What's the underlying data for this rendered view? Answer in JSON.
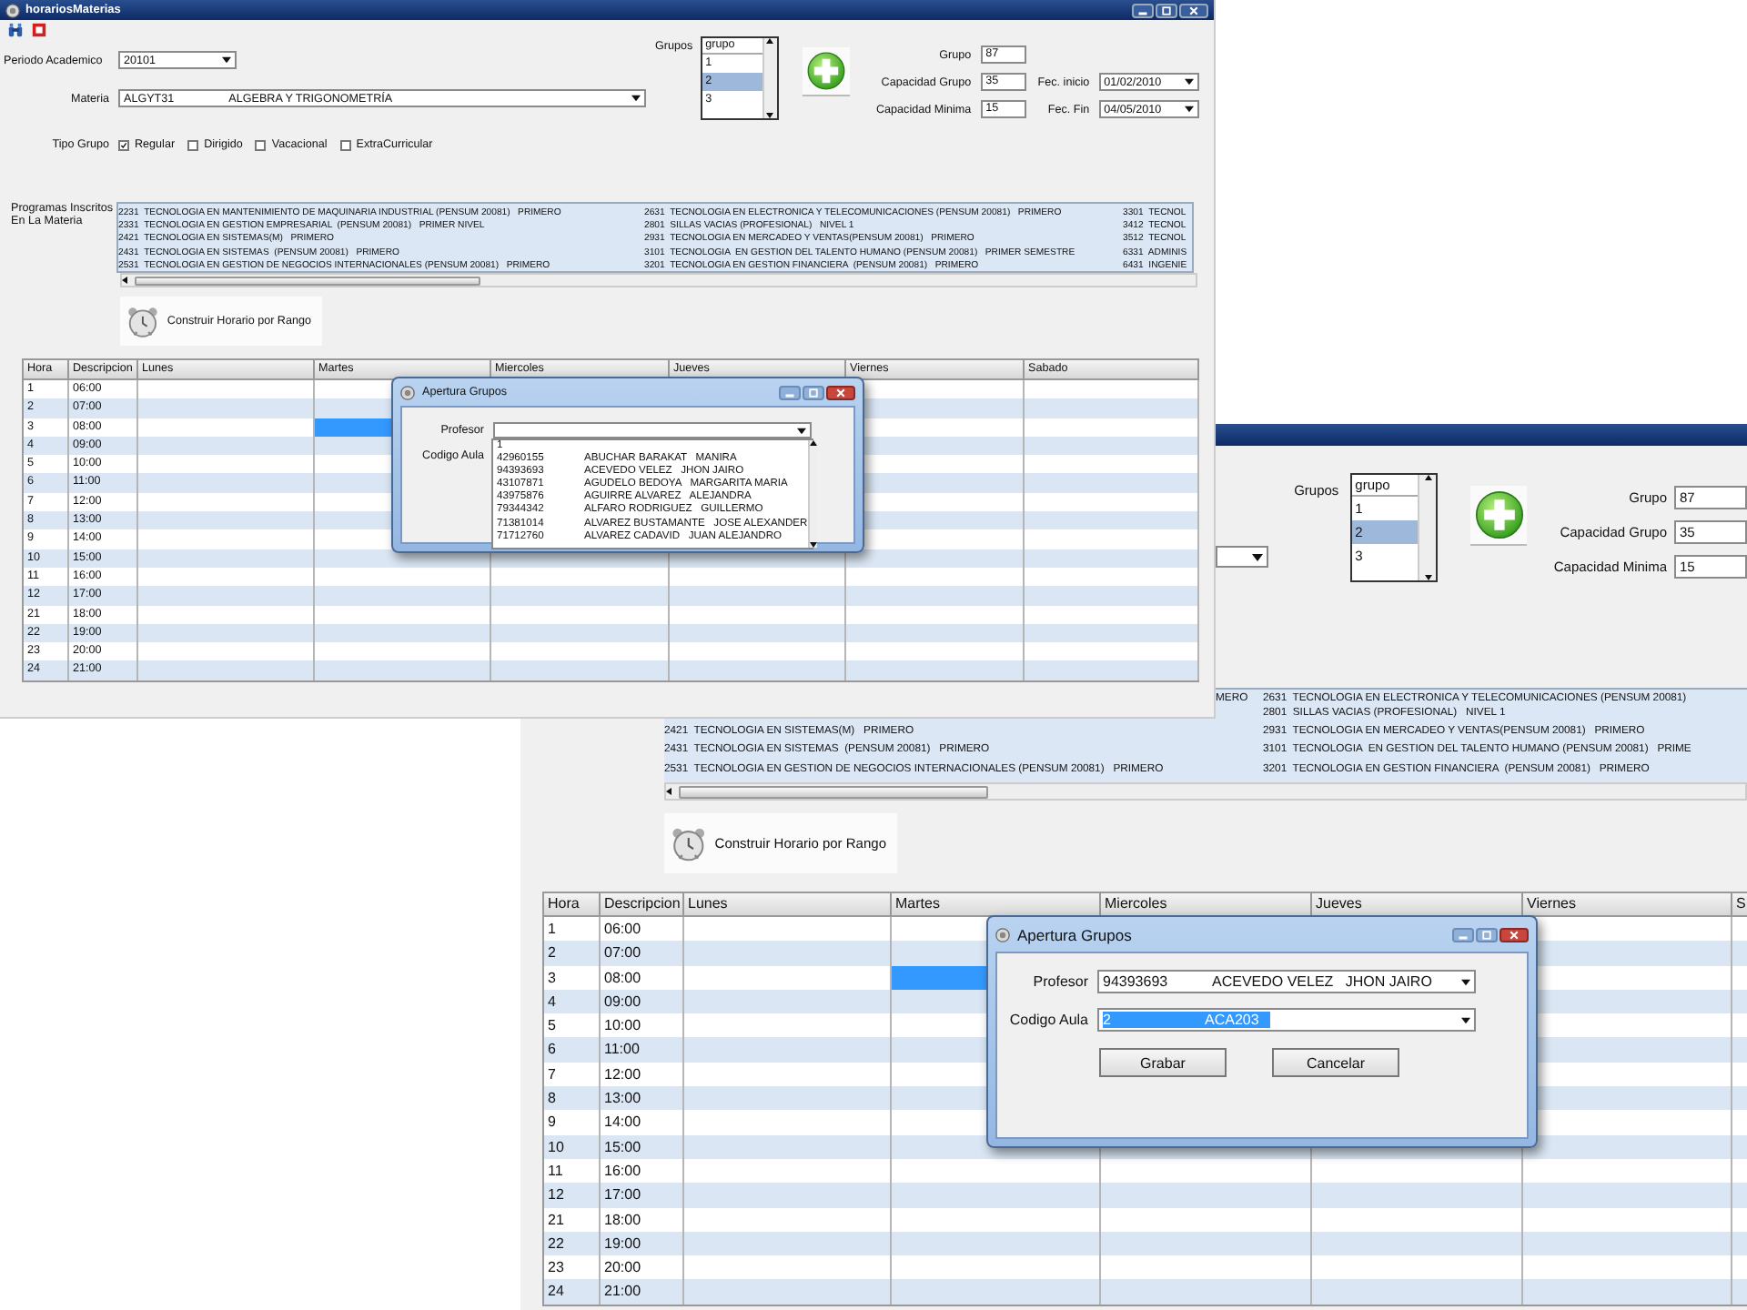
{
  "screenshot_1": {
    "window": {
      "title": "horariosMaterias"
    },
    "form": {
      "periodo": {
        "label": "Periodo Academico",
        "value": "20101"
      },
      "materia": {
        "label": "Materia",
        "code": "ALGYT31",
        "name": "ALGEBRA Y TRIGONOMETRÍA"
      },
      "tipo_grupo": {
        "label": "Tipo Grupo",
        "options": [
          {
            "label": "Regular",
            "checked": true
          },
          {
            "label": "Dirigido",
            "checked": false
          },
          {
            "label": "Vacacional",
            "checked": false
          },
          {
            "label": "ExtraCurricular",
            "checked": false
          }
        ]
      },
      "grupos": {
        "label": "Grupos",
        "header": "grupo",
        "items": [
          {
            "label": "1",
            "selected": false
          },
          {
            "label": "2",
            "selected": true
          },
          {
            "label": "3",
            "selected": false
          }
        ]
      },
      "fields": [
        {
          "label": "Grupo",
          "value": "87"
        },
        {
          "label": "Capacidad Grupo",
          "value": "35"
        },
        {
          "label": "Capacidad Minima",
          "value": "15"
        }
      ],
      "dates": [
        {
          "label": "Fec. inicio",
          "value": "01/02/2010"
        },
        {
          "label": "Fec. Fin",
          "value": "04/05/2010"
        }
      ]
    },
    "programs": {
      "label": "Programas Inscritos En La Materia",
      "rows": [
        {
          "col_1": "2231  TECNOLOGIA EN MANTENIMIENTO DE MAQUINARIA INDUSTRIAL (PENSUM 20081)   PRIMERO",
          "col_2": "2631  TECNOLOGIA EN ELECTRONICA Y TELECOMUNICACIONES (PENSUM 20081)   PRIMERO",
          "col_3": "3301  TECNOL"
        },
        {
          "col_1": "2331  TECNOLOGIA EN GESTION EMPRESARIAL  (PENSUM 20081)   PRIMER NIVEL",
          "col_2": "2801  SILLAS VACIAS (PROFESIONAL)   NIVEL 1",
          "col_3": "3412  TECNOL"
        },
        {
          "col_1": "2421  TECNOLOGIA EN SISTEMAS(M)   PRIMERO",
          "col_2": "2931  TECNOLOGIA EN MERCADEO Y VENTAS(PENSUM 20081)   PRIMERO",
          "col_3": "3512  TECNOL"
        },
        {
          "col_1": "2431  TECNOLOGIA EN SISTEMAS  (PENSUM 20081)   PRIMERO",
          "col_2": "3101  TECNOLOGIA  EN GESTION DEL TALENTO HUMANO (PENSUM 20081)   PRIMER SEMESTRE",
          "col_3": "6331  ADMINIS"
        },
        {
          "col_1": "2531  TECNOLOGIA EN GESTION DE NEGOCIOS INTERNACIONALES (PENSUM 20081)   PRIMERO",
          "col_2": "3201  TECNOLOGIA EN GESTION FINANCIERA  (PENSUM 20081)   PRIMERO",
          "col_3": "6431  INGENIE"
        }
      ]
    },
    "build_button": "Construir Horario por Rango",
    "schedule": {
      "columns": [
        "Hora",
        "Descripcion",
        "Lunes",
        "Martes",
        "Miercoles",
        "Jueves",
        "Viernes",
        "Sabado"
      ],
      "rows": [
        {
          "hora": "1",
          "descripcion": "06:00",
          "cells": {
            "lunes": {
              "selected": false
            },
            "martes": {
              "selected": false
            },
            "viernes": {
              "selected": false
            },
            "sabado": {
              "selected": false
            }
          }
        },
        {
          "hora": "2",
          "descripcion": "07:00",
          "cells": {
            "lunes": {
              "selected": false
            },
            "martes": {
              "selected": false
            },
            "viernes": {
              "selected": false
            },
            "sabado": {
              "selected": false
            }
          }
        },
        {
          "hora": "3",
          "descripcion": "08:00",
          "cells": {
            "lunes": {
              "selected": false
            },
            "martes": {
              "selected": true
            },
            "viernes": {
              "selected": false
            },
            "sabado": {
              "selected": false
            }
          }
        },
        {
          "hora": "4",
          "descripcion": "09:00",
          "cells": {
            "lunes": {
              "selected": false
            },
            "martes": {
              "selected": false
            },
            "viernes": {
              "selected": false
            },
            "sabado": {
              "selected": false
            }
          }
        },
        {
          "hora": "5",
          "descripcion": "10:00",
          "cells": {
            "lunes": {
              "selected": false
            },
            "martes": {
              "selected": false
            },
            "viernes": {
              "selected": false
            },
            "sabado": {
              "selected": false
            }
          }
        },
        {
          "hora": "6",
          "descripcion": "11:00",
          "cells": {
            "lunes": {
              "selected": false
            },
            "martes": {
              "selected": false
            },
            "viernes": {
              "selected": false
            },
            "sabado": {
              "selected": false
            }
          }
        },
        {
          "hora": "7",
          "descripcion": "12:00",
          "cells": {
            "lunes": {
              "selected": false
            },
            "martes": {
              "selected": false
            },
            "viernes": {
              "selected": false
            },
            "sabado": {
              "selected": false
            }
          }
        },
        {
          "hora": "8",
          "descripcion": "13:00",
          "cells": {
            "lunes": {
              "selected": false
            },
            "martes": {
              "selected": false
            },
            "viernes": {
              "selected": false
            },
            "sabado": {
              "selected": false
            }
          }
        },
        {
          "hora": "9",
          "descripcion": "14:00",
          "cells": {
            "lunes": {
              "selected": false
            },
            "martes": {
              "selected": false
            },
            "viernes": {
              "selected": false
            },
            "sabado": {
              "selected": false
            }
          }
        },
        {
          "hora": "10",
          "descripcion": "15:00",
          "cells": {
            "lunes": {
              "selected": false
            },
            "martes": {
              "selected": false
            },
            "miercoles": {
              "selected": false
            },
            "jueves": {
              "selected": false
            },
            "viernes": {
              "selected": false
            },
            "sabado": {
              "selected": false
            }
          }
        },
        {
          "hora": "11",
          "descripcion": "16:00",
          "cells": {
            "lunes": {
              "selected": false
            },
            "martes": {
              "selected": false
            },
            "miercoles": {
              "selected": false
            },
            "jueves": {
              "selected": false
            },
            "viernes": {
              "selected": false
            },
            "sabado": {
              "selected": false
            }
          }
        },
        {
          "hora": "12",
          "descripcion": "17:00",
          "cells": {
            "lunes": {
              "selected": false
            },
            "martes": {
              "selected": false
            },
            "miercoles": {
              "selected": false
            },
            "jueves": {
              "selected": false
            },
            "viernes": {
              "selected": false
            },
            "sabado": {
              "selected": false
            }
          }
        },
        {
          "hora": "21",
          "descripcion": "18:00",
          "cells": {
            "lunes": {
              "selected": false
            },
            "martes": {
              "selected": false
            },
            "miercoles": {
              "selected": false
            },
            "jueves": {
              "selected": false
            },
            "viernes": {
              "selected": false
            },
            "sabado": {
              "selected": false
            }
          }
        },
        {
          "hora": "22",
          "descripcion": "19:00",
          "cells": {
            "lunes": {
              "selected": false
            },
            "martes": {
              "selected": false
            },
            "miercoles": {
              "selected": false
            },
            "jueves": {
              "selected": false
            },
            "viernes": {
              "selected": false
            },
            "sabado": {
              "selected": false
            }
          }
        },
        {
          "hora": "23",
          "descripcion": "20:00",
          "cells": {
            "lunes": {
              "selected": false
            },
            "martes": {
              "selected": false
            },
            "miercoles": {
              "selected": false
            },
            "jueves": {
              "selected": false
            },
            "viernes": {
              "selected": false
            },
            "sabado": {
              "selected": false
            }
          }
        },
        {
          "hora": "24",
          "descripcion": "21:00",
          "cells": {
            "lunes": {
              "selected": false
            },
            "martes": {
              "selected": false
            },
            "miercoles": {
              "selected": false
            },
            "jueves": {
              "selected": false
            },
            "viernes": {
              "selected": false
            },
            "sabado": {
              "selected": false
            }
          }
        }
      ]
    },
    "dialog": {
      "title": "Apertura Grupos",
      "profesor_label": "Profesor",
      "codigo_aula_label": "Codigo Aula",
      "dropdown_items": [
        {
          "code": "1"
        },
        {
          "code": "42960155",
          "name": "ABUCHAR BARAKAT   MANIRA"
        },
        {
          "code": "94393693",
          "name": "ACEVEDO VELEZ   JHON JAIRO"
        },
        {
          "code": "43107871",
          "name": "AGUDELO BEDOYA   MARGARITA MARIA"
        },
        {
          "code": "43975876",
          "name": "AGUIRRE ALVAREZ   ALEJANDRA"
        },
        {
          "code": "79344342",
          "name": "ALFARO RODRIGUEZ   GUILLERMO"
        },
        {
          "code": "71381014",
          "name": "ALVAREZ BUSTAMANTE   JOSE ALEXANDER"
        },
        {
          "code": "71712760",
          "name": "ALVAREZ CADAVID   JUAN ALEJANDRO"
        }
      ]
    }
  },
  "screenshot_2": {
    "form": {
      "grupos": {
        "label": "Grupos",
        "header": "grupo",
        "items": [
          {
            "label": "1",
            "selected": false
          },
          {
            "label": "2",
            "selected": true
          },
          {
            "label": "3",
            "selected": false
          }
        ]
      },
      "fields": [
        {
          "label": "Grupo",
          "value": "87"
        },
        {
          "label": "Capacidad Grupo",
          "value": "35"
        },
        {
          "label": "Capacidad Minima",
          "value": "15"
        }
      ]
    },
    "programs": {
      "upper_rows": [
        {
          "col_1": "MERO",
          "col_2": "2631  TECNOLOGIA EN ELECTRONICA Y TELECOMUNICACIONES (PENSUM 20081)"
        },
        {
          "col_2": "2801  SILLAS VACIAS (PROFESIONAL)   NIVEL 1"
        }
      ],
      "rows": [
        {
          "col_1": "2421  TECNOLOGIA EN SISTEMAS(M)   PRIMERO",
          "col_2": "2931  TECNOLOGIA EN MERCADEO Y VENTAS(PENSUM 20081)   PRIMERO"
        },
        {
          "col_1": "2431  TECNOLOGIA EN SISTEMAS  (PENSUM 20081)   PRIMERO",
          "col_2": "3101  TECNOLOGIA  EN GESTION DEL TALENTO HUMANO (PENSUM 20081)   PRIME"
        },
        {
          "col_1": "2531  TECNOLOGIA EN GESTION DE NEGOCIOS INTERNACIONALES (PENSUM 20081)   PRIMERO",
          "col_2": "3201  TECNOLOGIA EN GESTION FINANCIERA  (PENSUM 20081)   PRIMERO"
        }
      ]
    },
    "build_button": "Construir Horario por Rango",
    "schedule": {
      "columns": [
        "Hora",
        "Descripcion",
        "Lunes",
        "Martes",
        "Miercoles",
        "Jueves",
        "Viernes",
        "S"
      ],
      "rows": [
        {
          "hora": "1",
          "descripcion": "06:00",
          "cells": {
            "lunes": {
              "selected": false
            },
            "martes": {
              "selected": false
            },
            "viernes": {
              "selected": false
            },
            "column_8": {
              "selected": false
            }
          }
        },
        {
          "hora": "2",
          "descripcion": "07:00",
          "cells": {
            "lunes": {
              "selected": false
            },
            "martes": {
              "selected": false
            },
            "viernes": {
              "selected": false
            },
            "column_8": {
              "selected": false
            }
          }
        },
        {
          "hora": "3",
          "descripcion": "08:00",
          "cells": {
            "lunes": {
              "selected": false
            },
            "martes": {
              "selected": true
            },
            "viernes": {
              "selected": false
            },
            "column_8": {
              "selected": false
            }
          }
        },
        {
          "hora": "4",
          "descripcion": "09:00",
          "cells": {
            "lunes": {
              "selected": false
            },
            "martes": {
              "selected": false
            },
            "viernes": {
              "selected": false
            },
            "column_8": {
              "selected": false
            }
          }
        },
        {
          "hora": "5",
          "descripcion": "10:00",
          "cells": {
            "lunes": {
              "selected": false
            },
            "martes": {
              "selected": false
            },
            "viernes": {
              "selected": false
            },
            "column_8": {
              "selected": false
            }
          }
        },
        {
          "hora": "6",
          "descripcion": "11:00",
          "cells": {
            "lunes": {
              "selected": false
            },
            "martes": {
              "selected": false
            },
            "viernes": {
              "selected": false
            },
            "column_8": {
              "selected": false
            }
          }
        },
        {
          "hora": "7",
          "descripcion": "12:00",
          "cells": {
            "lunes": {
              "selected": false
            },
            "martes": {
              "selected": false
            },
            "viernes": {
              "selected": false
            },
            "column_8": {
              "selected": false
            }
          }
        },
        {
          "hora": "8",
          "descripcion": "13:00",
          "cells": {
            "lunes": {
              "selected": false
            },
            "martes": {
              "selected": false
            },
            "viernes": {
              "selected": false
            },
            "column_8": {
              "selected": false
            }
          }
        },
        {
          "hora": "9",
          "descripcion": "14:00",
          "cells": {
            "lunes": {
              "selected": false
            },
            "martes": {
              "selected": false
            },
            "viernes": {
              "selected": false
            },
            "column_8": {
              "selected": false
            }
          }
        },
        {
          "hora": "10",
          "descripcion": "15:00",
          "cells": {
            "lunes": {
              "selected": false
            },
            "martes": {
              "selected": false
            },
            "miercoles": {
              "selected": false
            },
            "jueves": {
              "selected": false
            },
            "viernes": {
              "selected": false
            },
            "column_8": {
              "selected": false
            }
          }
        },
        {
          "hora": "11",
          "descripcion": "16:00",
          "cells": {
            "lunes": {
              "selected": false
            },
            "martes": {
              "selected": false
            },
            "miercoles": {
              "selected": false
            },
            "jueves": {
              "selected": false
            },
            "viernes": {
              "selected": false
            },
            "column_8": {
              "selected": false
            }
          }
        },
        {
          "hora": "12",
          "descripcion": "17:00",
          "cells": {
            "lunes": {
              "selected": false
            },
            "martes": {
              "selected": false
            },
            "miercoles": {
              "selected": false
            },
            "jueves": {
              "selected": false
            },
            "viernes": {
              "selected": false
            },
            "column_8": {
              "selected": false
            }
          }
        },
        {
          "hora": "21",
          "descripcion": "18:00",
          "cells": {
            "lunes": {
              "selected": false
            },
            "martes": {
              "selected": false
            },
            "miercoles": {
              "selected": false
            },
            "jueves": {
              "selected": false
            },
            "viernes": {
              "selected": false
            },
            "column_8": {
              "selected": false
            }
          }
        },
        {
          "hora": "22",
          "descripcion": "19:00",
          "cells": {
            "lunes": {
              "selected": false
            },
            "martes": {
              "selected": false
            },
            "miercoles": {
              "selected": false
            },
            "jueves": {
              "selected": false
            },
            "viernes": {
              "selected": false
            },
            "column_8": {
              "selected": false
            }
          }
        },
        {
          "hora": "23",
          "descripcion": "20:00",
          "cells": {
            "lunes": {
              "selected": false
            },
            "martes": {
              "selected": false
            },
            "miercoles": {
              "selected": false
            },
            "jueves": {
              "selected": false
            },
            "viernes": {
              "selected": false
            },
            "column_8": {
              "selected": false
            }
          }
        },
        {
          "hora": "24",
          "descripcion": "21:00",
          "cells": {
            "lunes": {
              "selected": false
            },
            "martes": {
              "selected": false
            },
            "miercoles": {
              "selected": false
            },
            "jueves": {
              "selected": false
            },
            "viernes": {
              "selected": false
            },
            "column_8": {
              "selected": false
            }
          }
        }
      ]
    },
    "dialog": {
      "title": "Apertura Grupos",
      "profesor": {
        "label": "Profesor",
        "code": "94393693",
        "name": "ACEVEDO VELEZ   JHON JAIRO"
      },
      "codigo_aula": {
        "label": "Codigo Aula",
        "code": "2",
        "name": "ACA203",
        "highlighted": true
      },
      "buttons": [
        "Grabar",
        "Cancelar"
      ]
    }
  }
}
